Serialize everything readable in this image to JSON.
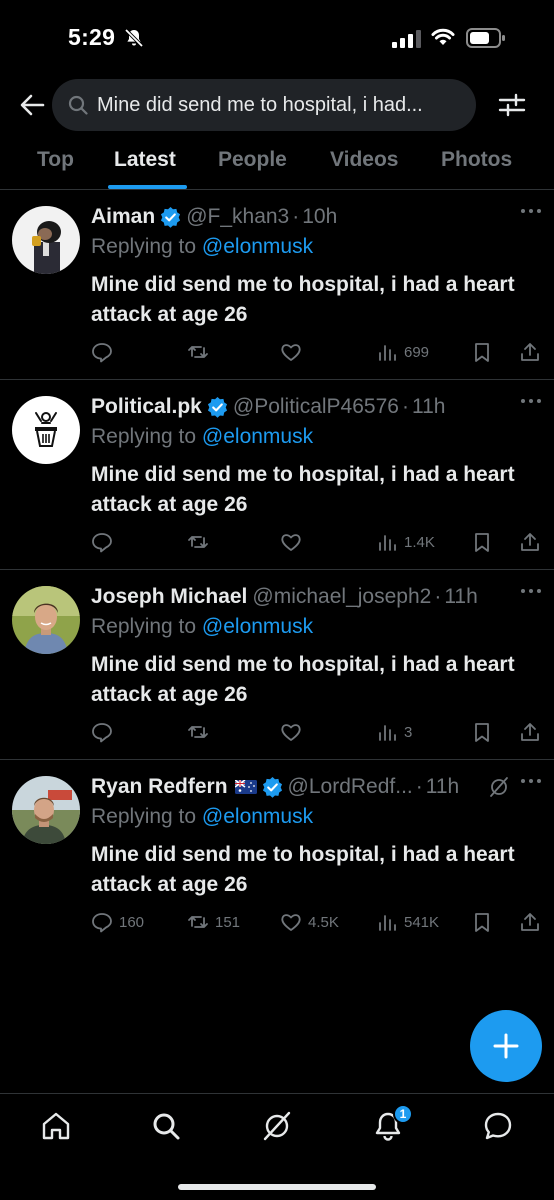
{
  "status_bar": {
    "time": "5:29"
  },
  "search": {
    "query": "Mine did send me to hospital, i had..."
  },
  "tabs": [
    {
      "label": "Top"
    },
    {
      "label": "Latest"
    },
    {
      "label": "People"
    },
    {
      "label": "Videos"
    },
    {
      "label": "Photos"
    }
  ],
  "tweets": [
    {
      "name": "Aiman",
      "handle": "@F_khan3",
      "time": "10h",
      "replying_prefix": "Replying to",
      "replying_to": "@elonmusk",
      "text": "Mine did send me to hospital, i had a heart attack at age 26",
      "views": "699",
      "replies": "",
      "retweets": "",
      "likes": ""
    },
    {
      "name": "Political.pk",
      "handle": "@PoliticalP46576",
      "time": "11h",
      "replying_prefix": "Replying to",
      "replying_to": "@elonmusk",
      "text": "Mine did send me to hospital, i had a heart attack at age 26",
      "views": "1.4K",
      "replies": "",
      "retweets": "",
      "likes": ""
    },
    {
      "name": "Joseph Michael",
      "handle": "@michael_joseph2",
      "time": "11h",
      "replying_prefix": "Replying to",
      "replying_to": "@elonmusk",
      "text": "Mine did send me to hospital, i had a heart attack at age 26",
      "views": "3",
      "replies": "",
      "retweets": "",
      "likes": ""
    },
    {
      "name": "Ryan Redfern",
      "handle": "@LordRedf...",
      "time": "11h",
      "replying_prefix": "Replying to",
      "replying_to": "@elonmusk",
      "text": "Mine did send me to hospital, i had a heart attack at age 26",
      "views": "541K",
      "replies": "160",
      "retweets": "151",
      "likes": "4.5K"
    }
  ],
  "notifications": {
    "badge_count": "1"
  },
  "colors": {
    "accent": "#1d9bf0",
    "muted": "#71767b",
    "text": "#e7e9ea",
    "background": "#000000",
    "divider": "#2f3336"
  }
}
